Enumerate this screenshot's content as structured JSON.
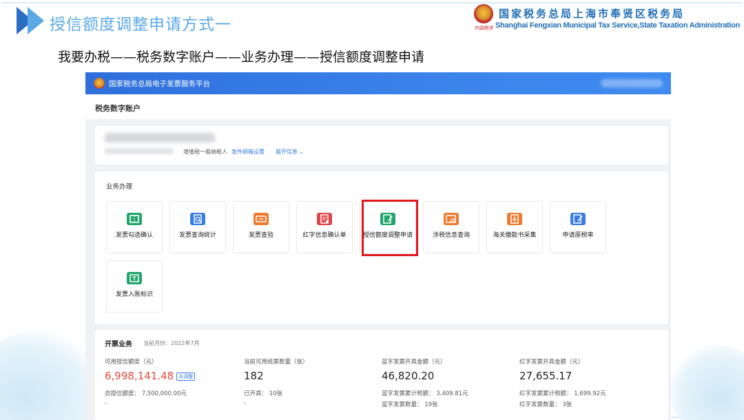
{
  "slide": {
    "title": "授信额度调整申请方式一",
    "org_cn": "国家税务总局上海市奉贤区税务局",
    "org_en": "Shanghai Fengxian Municipal Tax Service,State Taxation Administration",
    "seal_text": "中国税务",
    "breadcrumb": "我要办税——税务数字账户——业务办理——授信额度调整申请"
  },
  "platform": {
    "title": "国家税务总局电子发票服务平台",
    "page_title": "税务数字账户"
  },
  "account": {
    "taxpayer_type": "增值税一般纳税人",
    "mailbox_link": "发件邮箱设置",
    "expand_link": "展开信息 ⌄"
  },
  "business": {
    "section_title": "业务办理",
    "tiles": [
      {
        "label": "发票勾选确认",
        "icon": "ticket-icon",
        "color": "#22a56b"
      },
      {
        "label": "发票查询统计",
        "icon": "search-doc-icon",
        "color": "#3a7de0"
      },
      {
        "label": "发票查验",
        "icon": "ticket-verify-icon",
        "color": "#ee7a30"
      },
      {
        "label": "红字信息确认单",
        "icon": "red-doc-icon",
        "color": "#e0434a"
      },
      {
        "label": "授信额度调整申请",
        "icon": "edit-doc-icon",
        "color": "#22a56b"
      },
      {
        "label": "涉税信息查询",
        "icon": "info-search-icon",
        "color": "#ee7a30"
      },
      {
        "label": "海关缴款书采集",
        "icon": "download-doc-icon",
        "color": "#ee7a30"
      },
      {
        "label": "申请原税率",
        "icon": "pen-doc-icon",
        "color": "#3a7de0"
      },
      {
        "label": "发票入账标识",
        "icon": "stamp-icon",
        "color": "#22a56b"
      }
    ]
  },
  "invoicing": {
    "title": "开票业务",
    "month": "当前月份：2022年7月",
    "columns": [
      {
        "label": "可用授信额度（元）",
        "value": "6,998,141.48",
        "tag": "去调整",
        "sub1": "总授信额度：  7,500,000.00元",
        "sub2": "-"
      },
      {
        "label": "当前可用纸票数量（张）",
        "value": "182",
        "sub1": "已开具：   10张",
        "sub2": "-"
      },
      {
        "label": "蓝字发票开具金额（元）",
        "value": "46,820.20",
        "sub1": "蓝字发票累计税额：  3,409.81元",
        "sub2": "蓝字发票数量：  19张"
      },
      {
        "label": "红字发票开具金额（元）",
        "value": "27,655.17",
        "sub1": "红字发票累计税额：  1,699.92元",
        "sub2": "红字发票数量：  3张"
      }
    ]
  },
  "colors": {
    "accent_blue": "#3a7de0",
    "highlight_red": "#e0161d",
    "title_blue": "#5aa8e6",
    "value_red": "#e24a3b"
  }
}
